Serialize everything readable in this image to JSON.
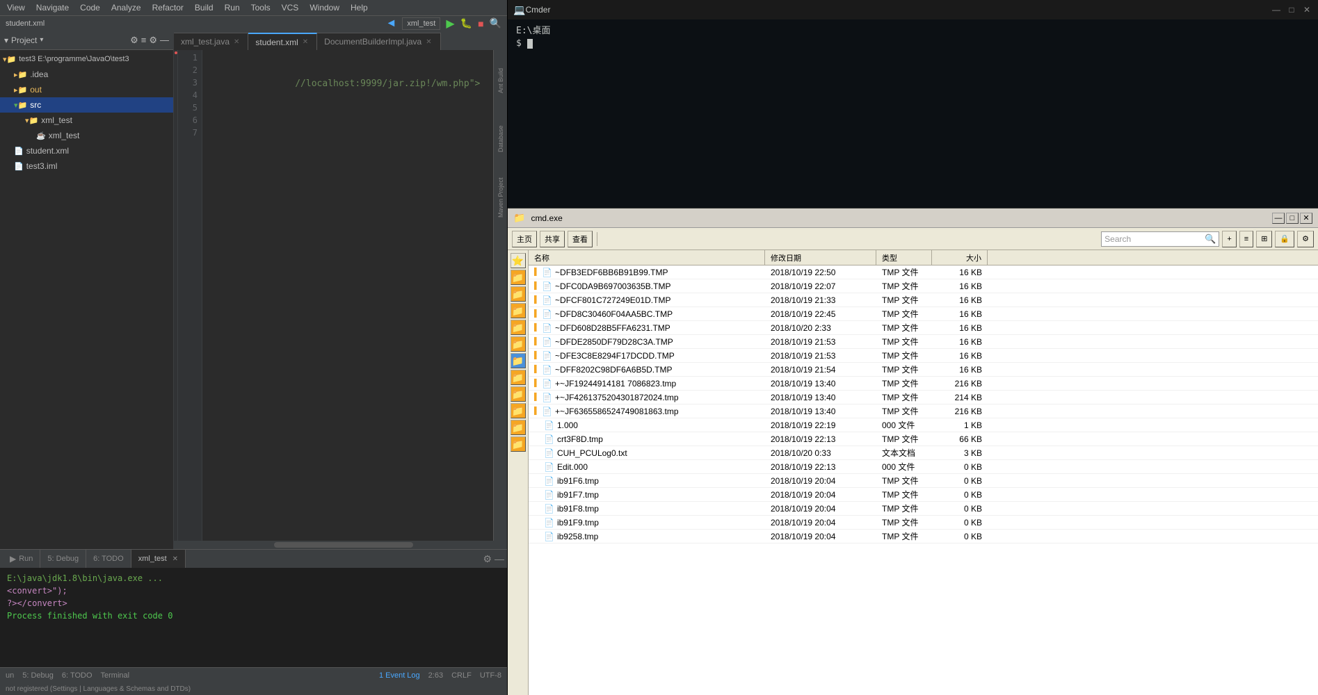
{
  "intellij": {
    "title": "student.xml",
    "menubar": [
      "View",
      "Navigate",
      "Code",
      "Analyze",
      "Refactor",
      "Build",
      "Run",
      "Tools",
      "VCS",
      "Window",
      "Help"
    ],
    "toolbar_config": "xml_test",
    "tabs": [
      {
        "label": "xml_test.java",
        "active": false
      },
      {
        "label": "student.xml",
        "active": true
      },
      {
        "label": "DocumentBuilderImpl.java",
        "active": false
      }
    ],
    "project_label": "Project",
    "project_root": "test3 E:\\programme\\JavaO\\test3",
    "tree_items": [
      {
        "label": ".idea",
        "indent": 1,
        "type": "folder"
      },
      {
        "label": "out",
        "indent": 1,
        "type": "folder"
      },
      {
        "label": "src",
        "indent": 1,
        "type": "src",
        "selected": true
      },
      {
        "label": "xml_test",
        "indent": 2,
        "type": "folder"
      },
      {
        "label": "xml_test",
        "indent": 3,
        "type": "file"
      },
      {
        "label": "student.xml",
        "indent": 1,
        "type": "xml"
      },
      {
        "label": "test3.iml",
        "indent": 1,
        "type": "iml"
      }
    ],
    "code_lines": [
      {
        "num": 1,
        "content": ""
      },
      {
        "num": 2,
        "content": "    //localhost:9999/jar.zip!/wm.php\">"
      },
      {
        "num": 3,
        "content": ""
      },
      {
        "num": 4,
        "content": ""
      },
      {
        "num": 5,
        "content": ""
      },
      {
        "num": 6,
        "content": ""
      },
      {
        "num": 7,
        "content": ""
      }
    ],
    "right_strips": [
      "Ant Build",
      "Database",
      "Maven Project"
    ],
    "terminal_tabs": [
      {
        "label": "Run",
        "active": false
      },
      {
        "label": "5: Debug",
        "active": false
      },
      {
        "label": "6: TODO",
        "active": false
      },
      {
        "label": "Terminal",
        "active": true
      }
    ],
    "terminal_tab_name": "xml_test",
    "terminal_lines": [
      {
        "text": "E:\\java\\jdk1.8\\bin\\java.exe ...",
        "class": "term-path"
      },
      {
        "text": "<convert>\");",
        "class": "term-magenta"
      },
      {
        "text": "?></convert>",
        "class": "term-magenta"
      },
      {
        "text": "Process finished with exit code 0",
        "class": "term-success"
      }
    ],
    "statusbar": {
      "left": [
        "un"
      ],
      "pos": "2:63",
      "encoding": "CRLF",
      "charset": "UTF-8",
      "event_log": "1 Event Log",
      "status_msg": "not registered (Settings | Languages & Schemas and DTDs)"
    }
  },
  "cmd": {
    "title": "Cmder",
    "path": "E:\\桌面",
    "prompt": "$"
  },
  "explorer": {
    "title": "cmd.exe",
    "search_placeholder": "Search",
    "toolbar_buttons": [
      "主页",
      "共享",
      "查看"
    ],
    "columns": [
      {
        "label": "名称",
        "class": "col-name"
      },
      {
        "label": "修改日期",
        "class": "col-date"
      },
      {
        "label": "类型",
        "class": "col-type"
      },
      {
        "label": "大小",
        "class": "col-size"
      }
    ],
    "files": [
      {
        "name": "~DFB3EDF6BB6B91B99.TMP",
        "date": "2018/10/19 22:50",
        "type": "TMP 文件",
        "size": "16 KB",
        "yellow": true
      },
      {
        "name": "~DFC0DA9B697003635B.TMP",
        "date": "2018/10/19 22:07",
        "type": "TMP 文件",
        "size": "16 KB",
        "yellow": true
      },
      {
        "name": "~DFCF801C727249E01D.TMP",
        "date": "2018/10/19 21:33",
        "type": "TMP 文件",
        "size": "16 KB",
        "yellow": true
      },
      {
        "name": "~DFD8C30460F04AA5BC.TMP",
        "date": "2018/10/19 22:45",
        "type": "TMP 文件",
        "size": "16 KB",
        "yellow": true
      },
      {
        "name": "~DFD608D28B5FFA6231.TMP",
        "date": "2018/10/20 2:33",
        "type": "TMP 文件",
        "size": "16 KB",
        "yellow": true
      },
      {
        "name": "~DFDE2850DF79D28C3A.TMP",
        "date": "2018/10/19 21:53",
        "type": "TMP 文件",
        "size": "16 KB",
        "yellow": true
      },
      {
        "name": "~DFE3C8E8294F17DCDD.TMP",
        "date": "2018/10/19 21:53",
        "type": "TMP 文件",
        "size": "16 KB",
        "yellow": true
      },
      {
        "name": "~DFF8202C98DF6A6B5D.TMP",
        "date": "2018/10/19 21:54",
        "type": "TMP 文件",
        "size": "16 KB",
        "yellow": true
      },
      {
        "name": "+~JF19244914181 7086823.tmp",
        "date": "2018/10/19 13:40",
        "type": "TMP 文件",
        "size": "216 KB",
        "yellow": true
      },
      {
        "name": "+~JF4261375204301872024.tmp",
        "date": "2018/10/19 13:40",
        "type": "TMP 文件",
        "size": "214 KB",
        "yellow": true
      },
      {
        "name": "+~JF6365586524749081863.tmp",
        "date": "2018/10/19 13:40",
        "type": "TMP 文件",
        "size": "216 KB",
        "yellow": true
      },
      {
        "name": "1.000",
        "date": "2018/10/19 22:19",
        "type": "000 文件",
        "size": "1 KB",
        "yellow": false
      },
      {
        "name": "crt3F8D.tmp",
        "date": "2018/10/19 22:13",
        "type": "TMP 文件",
        "size": "66 KB",
        "yellow": false
      },
      {
        "name": "CUH_PCULog0.txt",
        "date": "2018/10/20 0:33",
        "type": "文本文档",
        "size": "3 KB",
        "yellow": false
      },
      {
        "name": "Edit.000",
        "date": "2018/10/19 22:13",
        "type": "000 文件",
        "size": "0 KB",
        "yellow": false
      },
      {
        "name": "ib91F6.tmp",
        "date": "2018/10/19 20:04",
        "type": "TMP 文件",
        "size": "0 KB",
        "yellow": false
      },
      {
        "name": "ib91F7.tmp",
        "date": "2018/10/19 20:04",
        "type": "TMP 文件",
        "size": "0 KB",
        "yellow": false
      },
      {
        "name": "ib91F8.tmp",
        "date": "2018/10/19 20:04",
        "type": "TMP 文件",
        "size": "0 KB",
        "yellow": false
      },
      {
        "name": "ib91F9.tmp",
        "date": "2018/10/19 20:04",
        "type": "TMP 文件",
        "size": "0 KB",
        "yellow": false
      },
      {
        "name": "ib9258.tmp",
        "date": "2018/10/19 20:04",
        "type": "TMP 文件",
        "size": "0 KB",
        "yellow": false
      }
    ]
  }
}
